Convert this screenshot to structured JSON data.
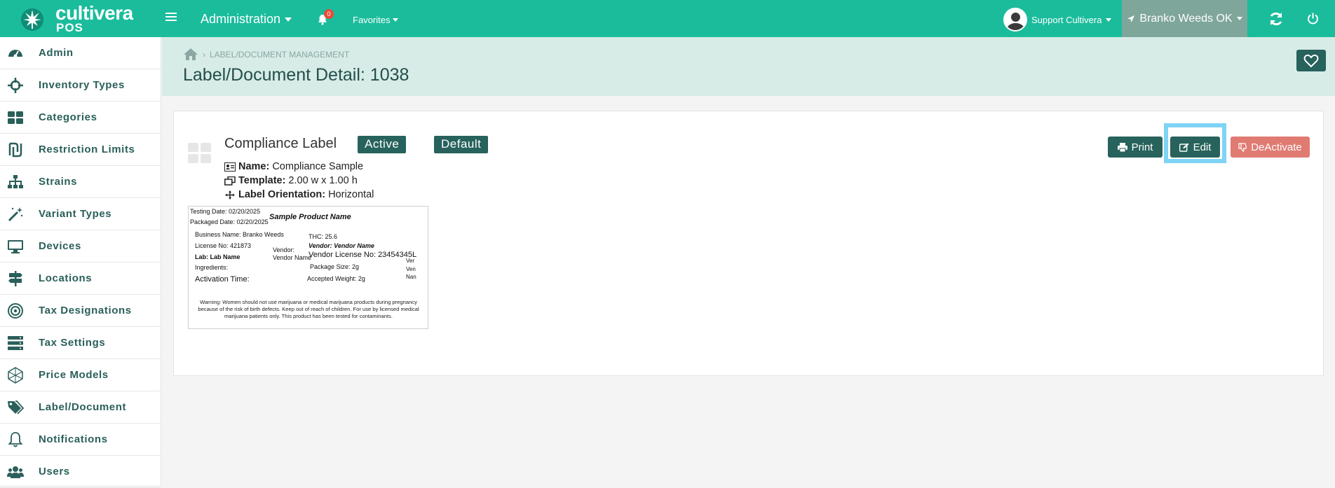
{
  "brand": {
    "name": "cultivera",
    "sub": "POS"
  },
  "topbar": {
    "admin_menu": "Administration",
    "notifications_count": "0",
    "favorites": "Favorites",
    "user": "Support Cultivera",
    "location": "Branko Weeds OK"
  },
  "sidebar": {
    "items": [
      {
        "label": "Admin",
        "icon": "dashboard-icon"
      },
      {
        "label": "Inventory Types",
        "icon": "crosshair-icon"
      },
      {
        "label": "Categories",
        "icon": "grid-icon"
      },
      {
        "label": "Restriction Limits",
        "icon": "shekel-icon"
      },
      {
        "label": "Strains",
        "icon": "sitemap-icon"
      },
      {
        "label": "Variant Types",
        "icon": "magic-wand-icon"
      },
      {
        "label": "Devices",
        "icon": "monitor-icon"
      },
      {
        "label": "Locations",
        "icon": "signpost-icon"
      },
      {
        "label": "Tax Designations",
        "icon": "target-icon"
      },
      {
        "label": "Tax Settings",
        "icon": "server-icon"
      },
      {
        "label": "Price Models",
        "icon": "polygon-icon"
      },
      {
        "label": "Label/Document",
        "icon": "tags-icon"
      },
      {
        "label": "Notifications",
        "icon": "bell-outline-icon"
      },
      {
        "label": "Users",
        "icon": "users-icon"
      }
    ]
  },
  "header": {
    "breadcrumb": "LABEL/DOCUMENT MANAGEMENT",
    "title": "Label/Document Detail: 1038"
  },
  "detail": {
    "label_name": "Compliance Label",
    "status_badge": "Active",
    "default_badge": "Default",
    "name_key": "Name:",
    "name_value": "Compliance Sample",
    "template_key": "Template:",
    "template_value": "2.00 w x 1.00 h",
    "orientation_key": "Label Orientation:",
    "orientation_value": "Horizontal",
    "buttons": {
      "print": "Print",
      "edit": "Edit",
      "deactivate": "DeActivate"
    }
  },
  "label_preview": {
    "testing_date": "Testing Date: 02/20/2025",
    "packaged_date": "Packaged Date: 02/20/2025",
    "product_name": "Sample Product Name",
    "business_name": "Business Name: Branko Weeds",
    "license_no": "License No: 421873",
    "lab": "Lab: Lab Name",
    "ingredients": "Ingredients:",
    "activation_time": "Activation Time:",
    "thc": "THC: 25.6",
    "vendor_bold": "Vendor: Vendor Name",
    "vendor_plain": "Vendor: Vendor Name",
    "vendor_license": "Vendor License No: 23454345L",
    "package_size": "Package Size: 2g",
    "accepted_weight": "Accepted Weight: 2g",
    "overflow_text": "Ver Ven Nan",
    "warning": "Warning: Women should not use marijuana or medical marijuana products during pregnancy because of the risk of birth defects. Keep out of reach of children. For use by licensed medical marijuana patients only. This product has been tested for contaminants."
  }
}
